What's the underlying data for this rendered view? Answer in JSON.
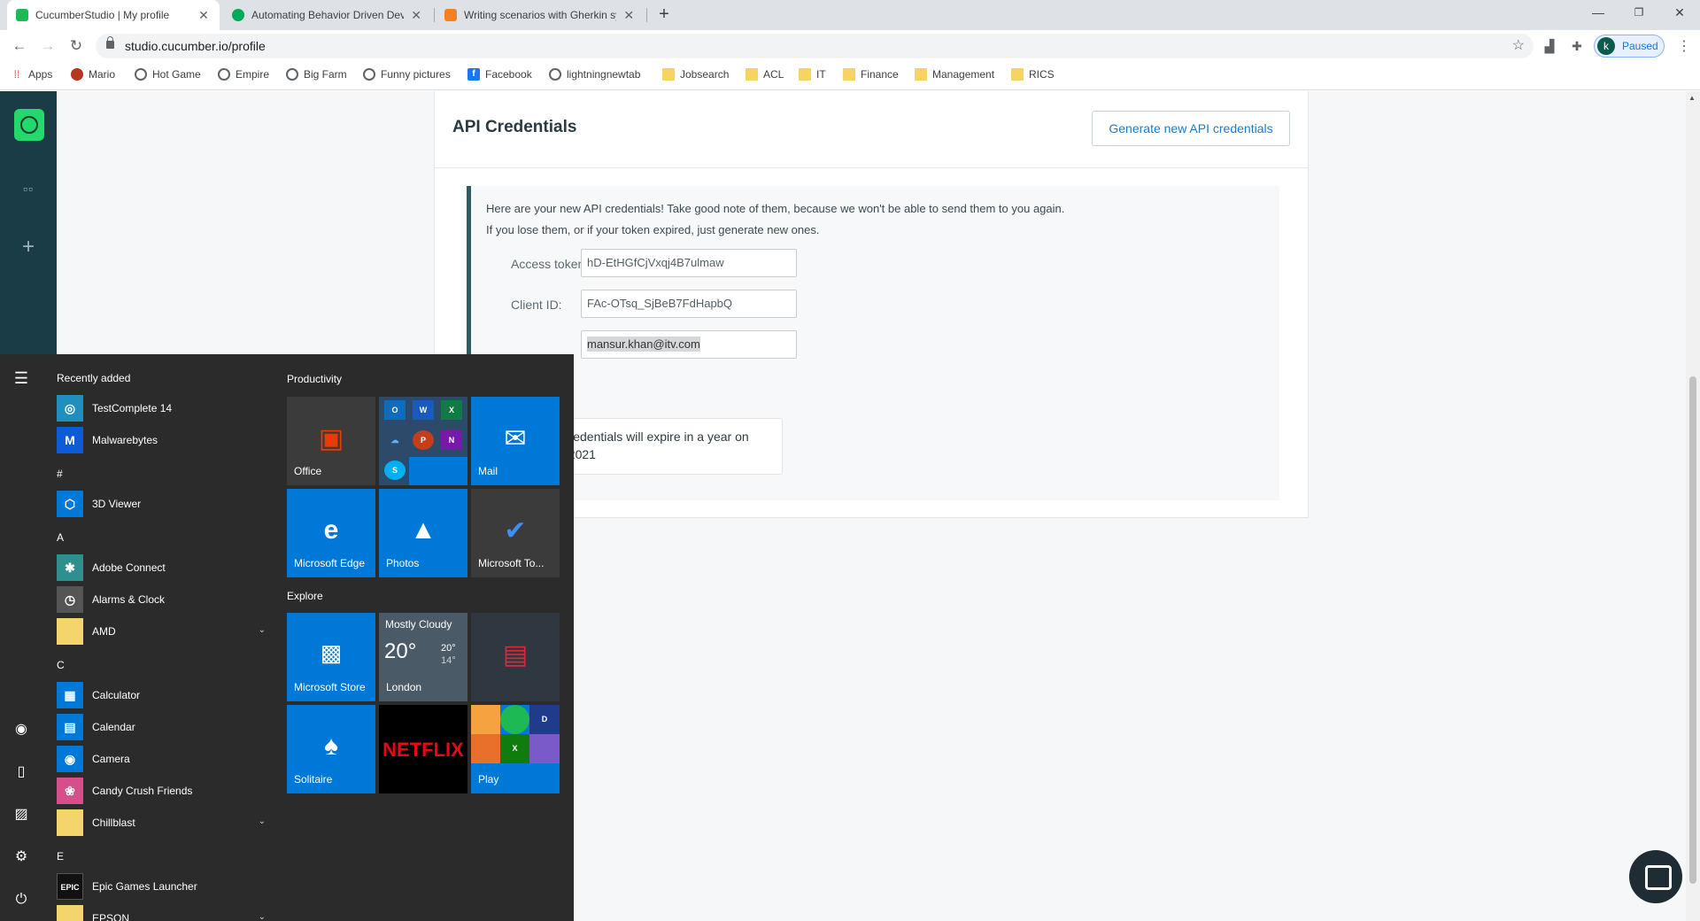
{
  "browser": {
    "tabs": [
      {
        "title": "CucumberStudio | My profile",
        "favicon_color": "#1db954"
      },
      {
        "title": "Automating Behavior Driven Dev",
        "favicon_color": "#00a85a"
      },
      {
        "title": "Writing scenarios with Gherkin sy",
        "favicon_color": "#f48024"
      }
    ],
    "new_tab_symbol": "+",
    "window_buttons": {
      "minimize": "—",
      "restore": "❐",
      "close": "✕"
    },
    "url": "studio.cucumber.io/profile",
    "profile": {
      "initial": "k",
      "status": "Paused"
    },
    "bookmarks": [
      {
        "label": "Apps",
        "icon": "apps-grid-icon"
      },
      {
        "label": "Mario",
        "icon": "mario-icon"
      },
      {
        "label": "Hot Game",
        "icon": "globe-icon"
      },
      {
        "label": "Empire",
        "icon": "globe-icon"
      },
      {
        "label": "Big Farm",
        "icon": "globe-icon"
      },
      {
        "label": "Funny pictures",
        "icon": "globe-icon"
      },
      {
        "label": "Facebook",
        "icon": "facebook-icon"
      },
      {
        "label": "lightningnewtab",
        "icon": "globe-icon"
      },
      {
        "label": "Jobsearch",
        "icon": "folder-icon"
      },
      {
        "label": "ACL",
        "icon": "folder-icon"
      },
      {
        "label": "IT",
        "icon": "folder-icon"
      },
      {
        "label": "Finance",
        "icon": "folder-icon"
      },
      {
        "label": "Management",
        "icon": "folder-icon"
      },
      {
        "label": "RICS",
        "icon": "folder-icon"
      }
    ]
  },
  "sidebar": {
    "items": [
      {
        "icon": "cucumber-logo-icon"
      },
      {
        "icon": "grid-icon",
        "glyph": "▫▫"
      },
      {
        "icon": "plus-icon",
        "glyph": "+"
      }
    ]
  },
  "api_credentials": {
    "title": "API Credentials",
    "generate_button": "Generate new API credentials",
    "notice_line1": "Here are your new API credentials! Take good note of them, because we won't be able to send them to you again.",
    "notice_line2": "If you lose them, or if your token expired, just generate new ones.",
    "access_token_label": "Access token:",
    "access_token_value": "hD-EtHGfCjVxqj4B7ulmaw",
    "client_id_label": "Client ID:",
    "client_id_value": "FAc-OTsq_SjBeB7FdHapbQ",
    "email_value": "mansur.khan@itv.com",
    "expiry_line1": "r credentials will expire in a year on",
    "expiry_line2": "ul 2021"
  },
  "start_menu": {
    "recently_added_label": "Recently added",
    "productivity_label": "Productivity",
    "explore_label": "Explore",
    "apps": [
      {
        "type": "app",
        "label": "TestComplete 14",
        "icon": "testcomplete-icon",
        "color": "#1f8fbf"
      },
      {
        "type": "app",
        "label": "Malwarebytes",
        "icon": "malwarebytes-icon",
        "color": "#0d5bd7"
      },
      {
        "type": "section",
        "label": "#"
      },
      {
        "type": "app",
        "label": "3D Viewer",
        "icon": "3d-viewer-icon",
        "color": "#0078d7"
      },
      {
        "type": "section",
        "label": "A"
      },
      {
        "type": "app",
        "label": "Adobe Connect",
        "icon": "adobe-connect-icon",
        "color": "#2f8f8f"
      },
      {
        "type": "app",
        "label": "Alarms & Clock",
        "icon": "clock-icon",
        "color": "#555555"
      },
      {
        "type": "folder",
        "label": "AMD",
        "icon": "folder-icon",
        "color": "#f3d56b"
      },
      {
        "type": "section",
        "label": "C"
      },
      {
        "type": "app",
        "label": "Calculator",
        "icon": "calculator-icon",
        "color": "#0078d7"
      },
      {
        "type": "app",
        "label": "Calendar",
        "icon": "calendar-icon",
        "color": "#0078d7"
      },
      {
        "type": "app",
        "label": "Camera",
        "icon": "camera-icon",
        "color": "#0078d7"
      },
      {
        "type": "app",
        "label": "Candy Crush Friends",
        "icon": "candy-crush-icon",
        "color": "#d64f8a"
      },
      {
        "type": "folder",
        "label": "Chillblast",
        "icon": "folder-icon",
        "color": "#f3d56b"
      },
      {
        "type": "section",
        "label": "E"
      },
      {
        "type": "app",
        "label": "Epic Games Launcher",
        "icon": "epic-games-icon",
        "color": "#111111"
      },
      {
        "type": "folder",
        "label": "EPSON",
        "icon": "folder-icon",
        "color": "#f3d56b"
      }
    ],
    "tiles": {
      "office": "Office",
      "mail": "Mail",
      "edge": "Microsoft Edge",
      "photos": "Photos",
      "todo": "Microsoft To...",
      "store": "Microsoft Store",
      "weather_condition": "Mostly Cloudy",
      "weather_temp": "20°",
      "weather_high": "20°",
      "weather_low": "14°",
      "weather_city": "London",
      "solitaire": "Solitaire",
      "netflix": "NETFLIX",
      "play": "Play"
    }
  }
}
